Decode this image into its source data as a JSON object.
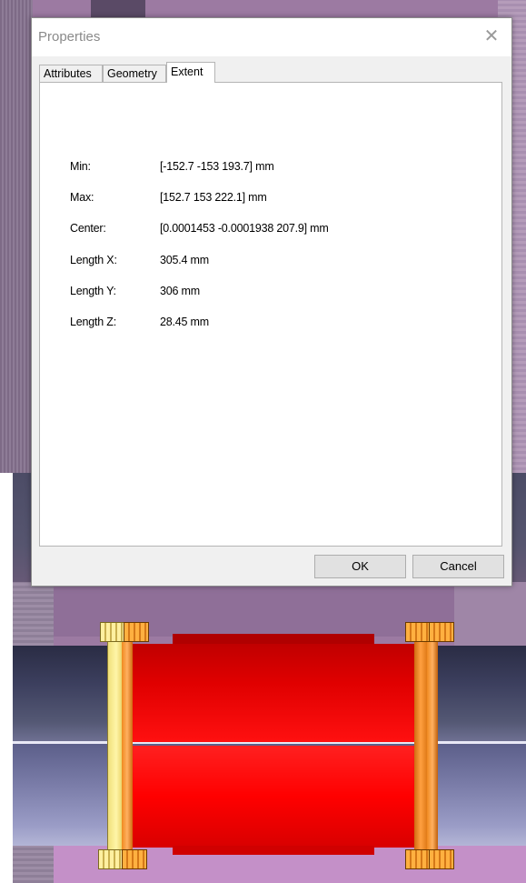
{
  "dialog": {
    "title": "Properties",
    "close_icon": "close-icon",
    "tabs": [
      {
        "label": "Attributes",
        "active": false
      },
      {
        "label": "Geometry",
        "active": false
      },
      {
        "label": "Extent",
        "active": true
      }
    ],
    "extent": {
      "rows": [
        {
          "label": "Min:",
          "value": "[-152.7 -153 193.7] mm"
        },
        {
          "label": "Max:",
          "value": "[152.7 153 222.1] mm"
        },
        {
          "label": "Center:",
          "value": "[0.0001453 -0.0001938 207.9] mm"
        },
        {
          "label": "Length X:",
          "value": "305.4 mm"
        },
        {
          "label": "Length Y:",
          "value": "306 mm"
        },
        {
          "label": "Length Z:",
          "value": "28.45 mm"
        }
      ]
    },
    "buttons": {
      "ok_label": "OK",
      "cancel_label": "Cancel"
    }
  },
  "colors": {
    "sleeve": "#ff0000",
    "ring_yellow": "#fff5a8",
    "ring_orange": "#f08a20",
    "pipe": "#3c3f5e",
    "background": "#9c7aa2"
  }
}
